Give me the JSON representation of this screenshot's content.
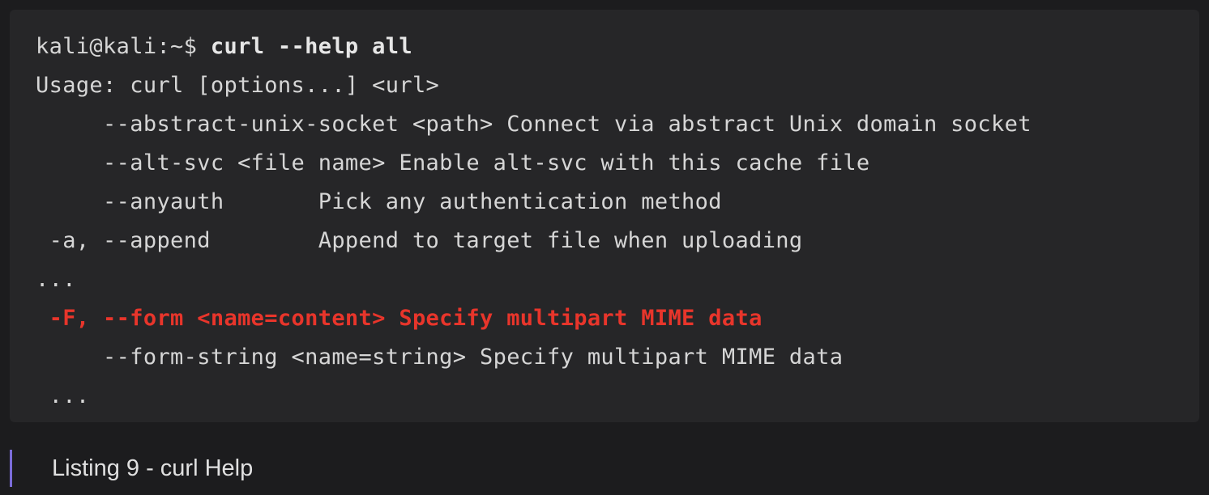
{
  "terminal": {
    "prompt": "kali@kali:~$ ",
    "command": "curl --help all",
    "lines": [
      "Usage: curl [options...] <url>",
      "     --abstract-unix-socket <path> Connect via abstract Unix domain socket",
      "     --alt-svc <file name> Enable alt-svc with this cache file",
      "     --anyauth       Pick any authentication method",
      " -a, --append        Append to target file when uploading",
      "...",
      " -F, --form <name=content> Specify multipart MIME data",
      "     --form-string <name=string> Specify multipart MIME data",
      " ..."
    ],
    "highlight_color": "#e8352b"
  },
  "caption": {
    "text": "Listing 9 - curl Help",
    "accent_color": "#7b6cd9"
  }
}
